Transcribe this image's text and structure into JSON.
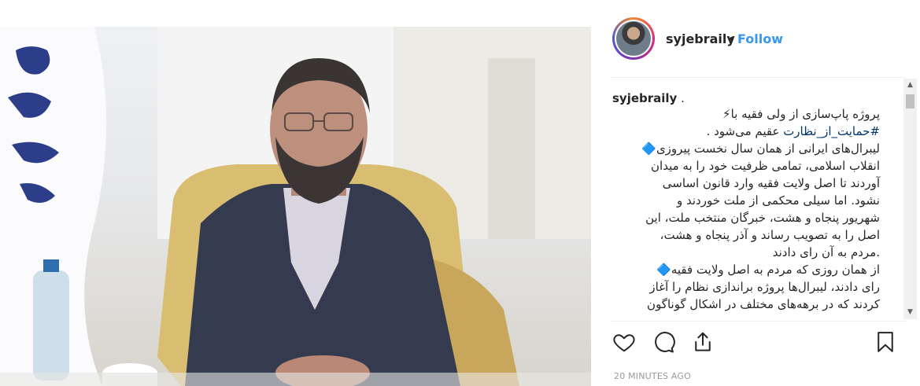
{
  "post": {
    "username": "syjebraily",
    "separator": "•",
    "follow_label": "Follow",
    "caption_username": "syjebraily",
    "caption_username_suffix": " .",
    "caption_lines": [
      "پروژه پاپ‌سازی از ولی فقیه با⚡",
      "",
      "لیبرال‌های ایرانی از همان سال نخست پیروزی🔷",
      "انقلاب اسلامی، تمامی ظرفیت خود را به میدان",
      "آوردند تا اصل ولایت فقیه وارد قانون اساسی",
      "نشود. اما سیلی محکمی از ملت خوردند و",
      "شهریور پنجاه و هشت، خبرگان منتخب ملت، این",
      "اصل را به تصویب رساند و آذر پنجاه و هشت،",
      ".مردم به آن رای دادند",
      "از همان روزی که مردم به اصل ولایت فقیه🔷",
      "رای دادند، لیبرال‌ها پروژه براندازی نظام را آغاز",
      "کردند که در برهه‌های مختلف در اشکال گوناگون"
    ],
    "caption_line2_hashtag": "#حمایت_از_نظارت",
    "caption_line2_text": " عقیم می‌شود .",
    "timestamp": "20 MINUTES AGO"
  },
  "icons": {
    "like": "heart-icon",
    "comment": "comment-icon",
    "share": "share-icon",
    "save": "bookmark-icon"
  },
  "colors": {
    "follow": "#3897f0",
    "hashtag": "#003569",
    "timestamp": "#999999"
  }
}
